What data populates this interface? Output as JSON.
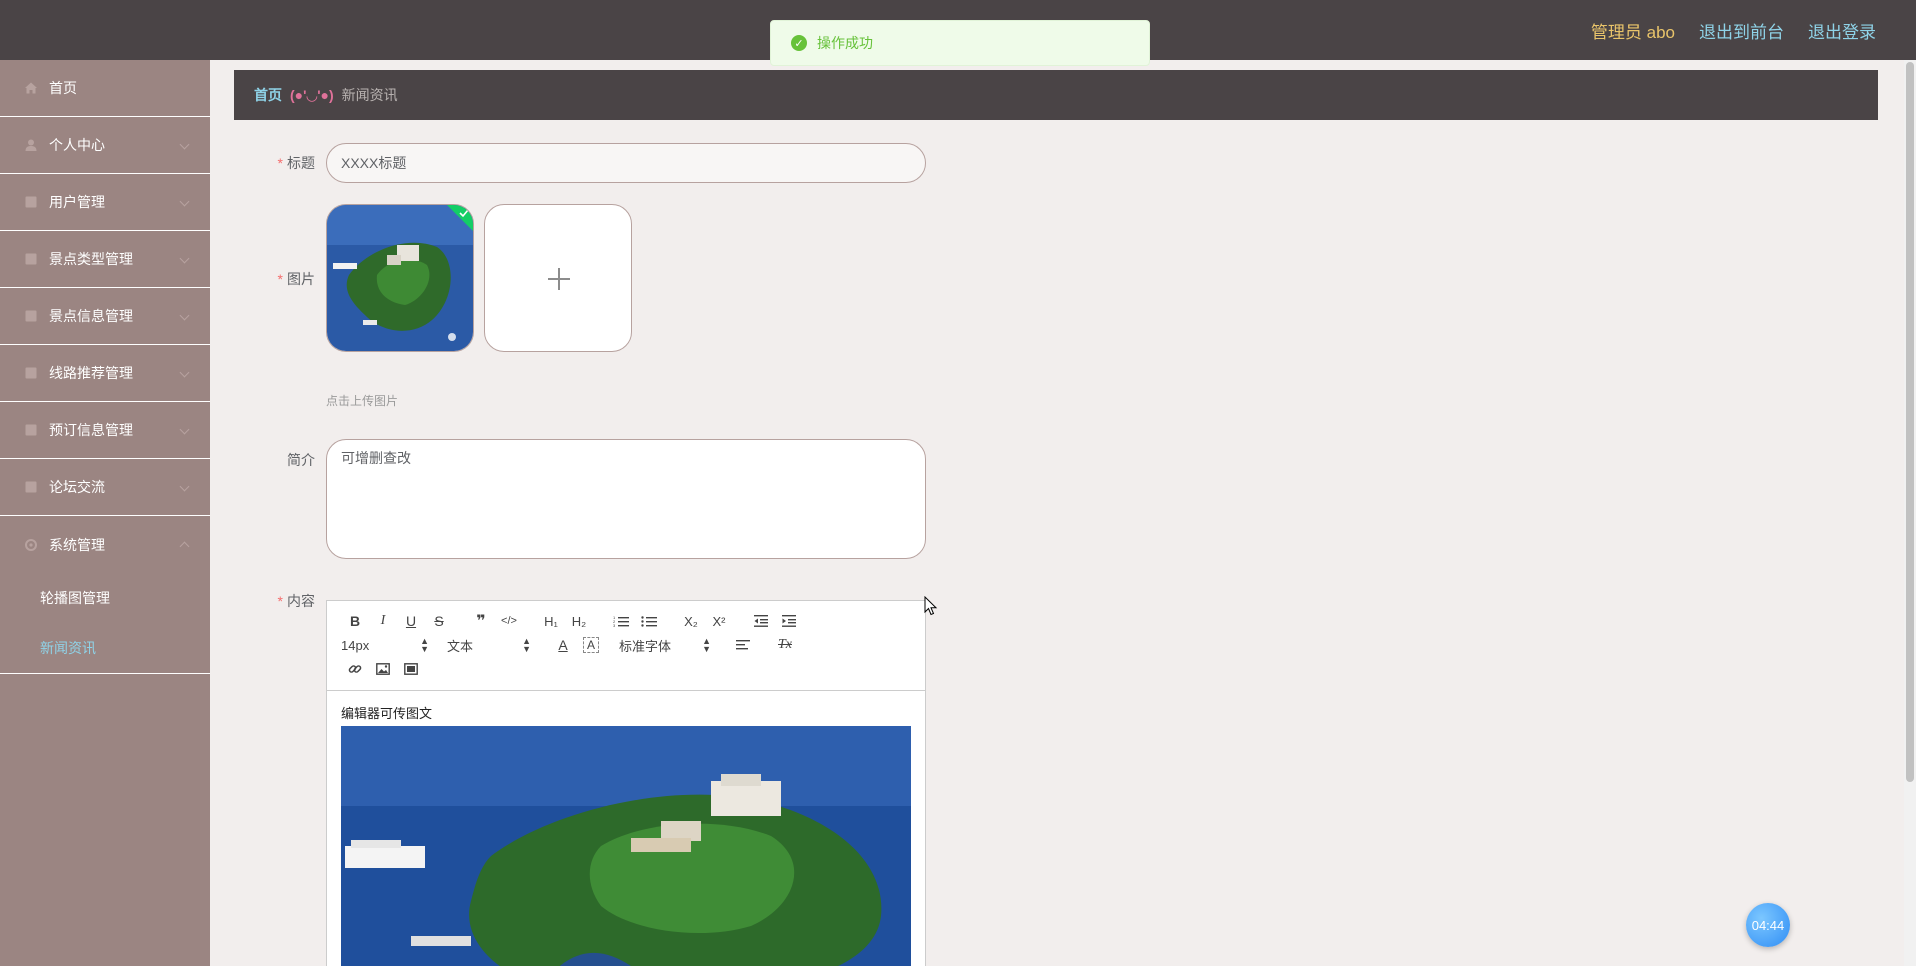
{
  "header": {
    "admin_label": "管理员 abo",
    "front_label": "退出到前台",
    "logout_label": "退出登录"
  },
  "toast": {
    "message": "操作成功"
  },
  "sidebar": {
    "items": [
      {
        "label": "首页",
        "icon": "home-icon"
      },
      {
        "label": "个人中心",
        "icon": "user-icon"
      },
      {
        "label": "用户管理",
        "icon": "list-icon"
      },
      {
        "label": "景点类型管理",
        "icon": "list-icon"
      },
      {
        "label": "景点信息管理",
        "icon": "list-icon"
      },
      {
        "label": "线路推荐管理",
        "icon": "list-icon"
      },
      {
        "label": "预订信息管理",
        "icon": "list-icon"
      },
      {
        "label": "论坛交流",
        "icon": "list-icon"
      },
      {
        "label": "系统管理",
        "icon": "gear-icon"
      }
    ],
    "sub_items": [
      {
        "label": "轮播图管理"
      },
      {
        "label": "新闻资讯",
        "active": true
      }
    ]
  },
  "breadcrumb": {
    "home": "首页",
    "separator": "(●'◡'●)",
    "current": "新闻资讯"
  },
  "form": {
    "title_label": "标题",
    "title_value": "XXXX标题",
    "image_label": "图片",
    "upload_tip": "点击上传图片",
    "intro_label": "简介",
    "intro_value": "可增删查改",
    "content_label": "内容",
    "required_mark": "*"
  },
  "editor": {
    "font_size": "14px",
    "block_format": "文本",
    "font_family": "标准字体",
    "body_text": "编辑器可传图文"
  },
  "timer": {
    "label": "04:44"
  },
  "colors": {
    "header_bg": "#4a4446",
    "sidebar_bg": "#9b8582",
    "accent": "#8fd3e8",
    "admin_text": "#e9c46a",
    "success": "#67c23a"
  }
}
